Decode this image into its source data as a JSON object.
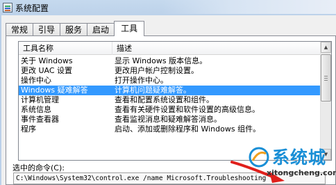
{
  "window": {
    "title": "系统配置"
  },
  "tabs": [
    {
      "label": "常规",
      "active": false
    },
    {
      "label": "引导",
      "active": false
    },
    {
      "label": "服务",
      "active": false
    },
    {
      "label": "启动",
      "active": false
    },
    {
      "label": "工具",
      "active": true
    }
  ],
  "tool_list": {
    "columns": {
      "name": "工具名称",
      "desc": "描述"
    },
    "rows": [
      {
        "name": "关于 Windows",
        "desc": "显示 Windows 版本信息。"
      },
      {
        "name": "更改 UAC 设置",
        "desc": "更改用户帐户控制设置。"
      },
      {
        "name": "操作中心",
        "desc": "打开操作中心。"
      },
      {
        "name": "Windows 疑难解答",
        "desc": "计算机问题疑难解答。",
        "selected": true
      },
      {
        "name": "计算机管理",
        "desc": "查看和配置系统设置和组件。"
      },
      {
        "name": "系统信息",
        "desc": "查看有关硬件设置和软件设置的高级信息。"
      },
      {
        "name": "事件查看器",
        "desc": "查看监视消息和疑难解答消息。"
      },
      {
        "name": "程序",
        "desc": "启动、添加或删除程序和 Windows 组件。"
      },
      {
        "name": "",
        "desc": ""
      }
    ]
  },
  "command": {
    "label": "选中的命令(C):",
    "value": "C:\\Windows\\System32\\control.exe /name Microsoft.Troubleshooting"
  },
  "watermark": {
    "brand": "系统城",
    "url": "xitongcheng.com"
  },
  "colors": {
    "selection": "#3399ff",
    "accent_arrow": "#e0201c",
    "watermark": "#1a8fd6"
  }
}
